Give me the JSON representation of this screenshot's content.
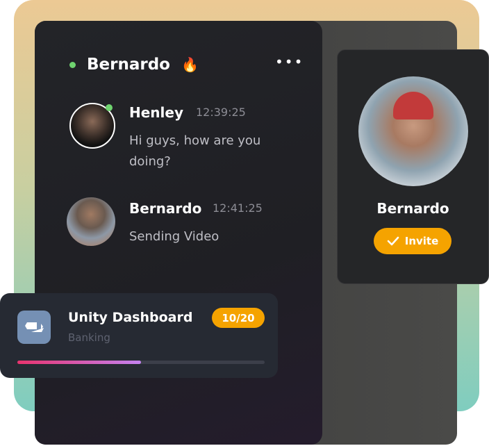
{
  "chat": {
    "title": "Bernardo",
    "emoji": "🔥",
    "more": "•••",
    "messages": [
      {
        "name": "Henley",
        "time": "12:39:25",
        "text": "Hi guys, how are you doing?",
        "online": true
      },
      {
        "name": "Bernardo",
        "time": "12:41:25",
        "text": "Sending Video",
        "online": false
      }
    ]
  },
  "profile": {
    "name": "Bernardo",
    "invite_label": "Invite"
  },
  "task": {
    "title": "Unity Dashboard",
    "subtitle": "Banking",
    "badge": "10/20",
    "progress": 0.5
  },
  "colors": {
    "accent": "#f5a300",
    "online": "#6fd36f"
  }
}
